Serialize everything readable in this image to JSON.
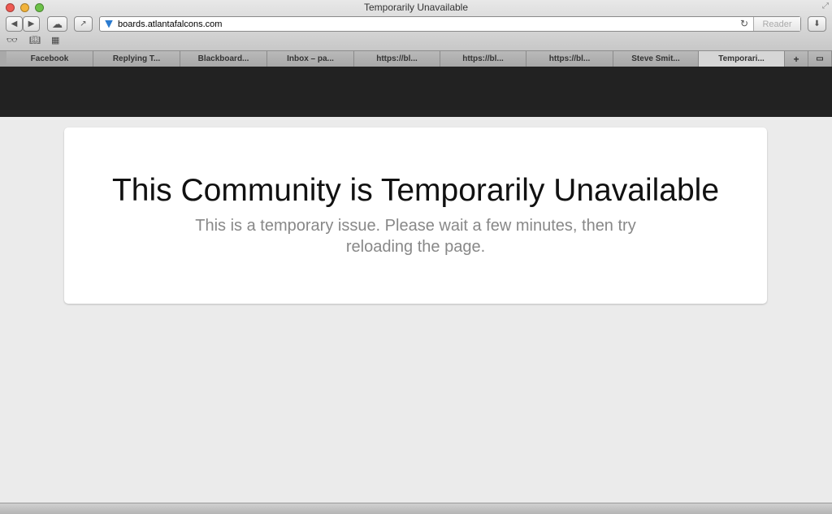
{
  "window": {
    "title": "Temporarily Unavailable"
  },
  "toolbar": {
    "url": "boards.atlantafalcons.com",
    "reader_label": "Reader"
  },
  "tabs": [
    {
      "label": "Facebook"
    },
    {
      "label": "Replying T..."
    },
    {
      "label": "Blackboard..."
    },
    {
      "label": "Inbox – pa..."
    },
    {
      "label": "https://bl..."
    },
    {
      "label": "https://bl..."
    },
    {
      "label": "https://bl..."
    },
    {
      "label": "Steve Smit..."
    },
    {
      "label": "Temporari...",
      "active": true
    }
  ],
  "page": {
    "heading": "This Community is Temporarily Unavailable",
    "message": "This is a temporary issue. Please wait a few minutes, then try reloading the page."
  }
}
